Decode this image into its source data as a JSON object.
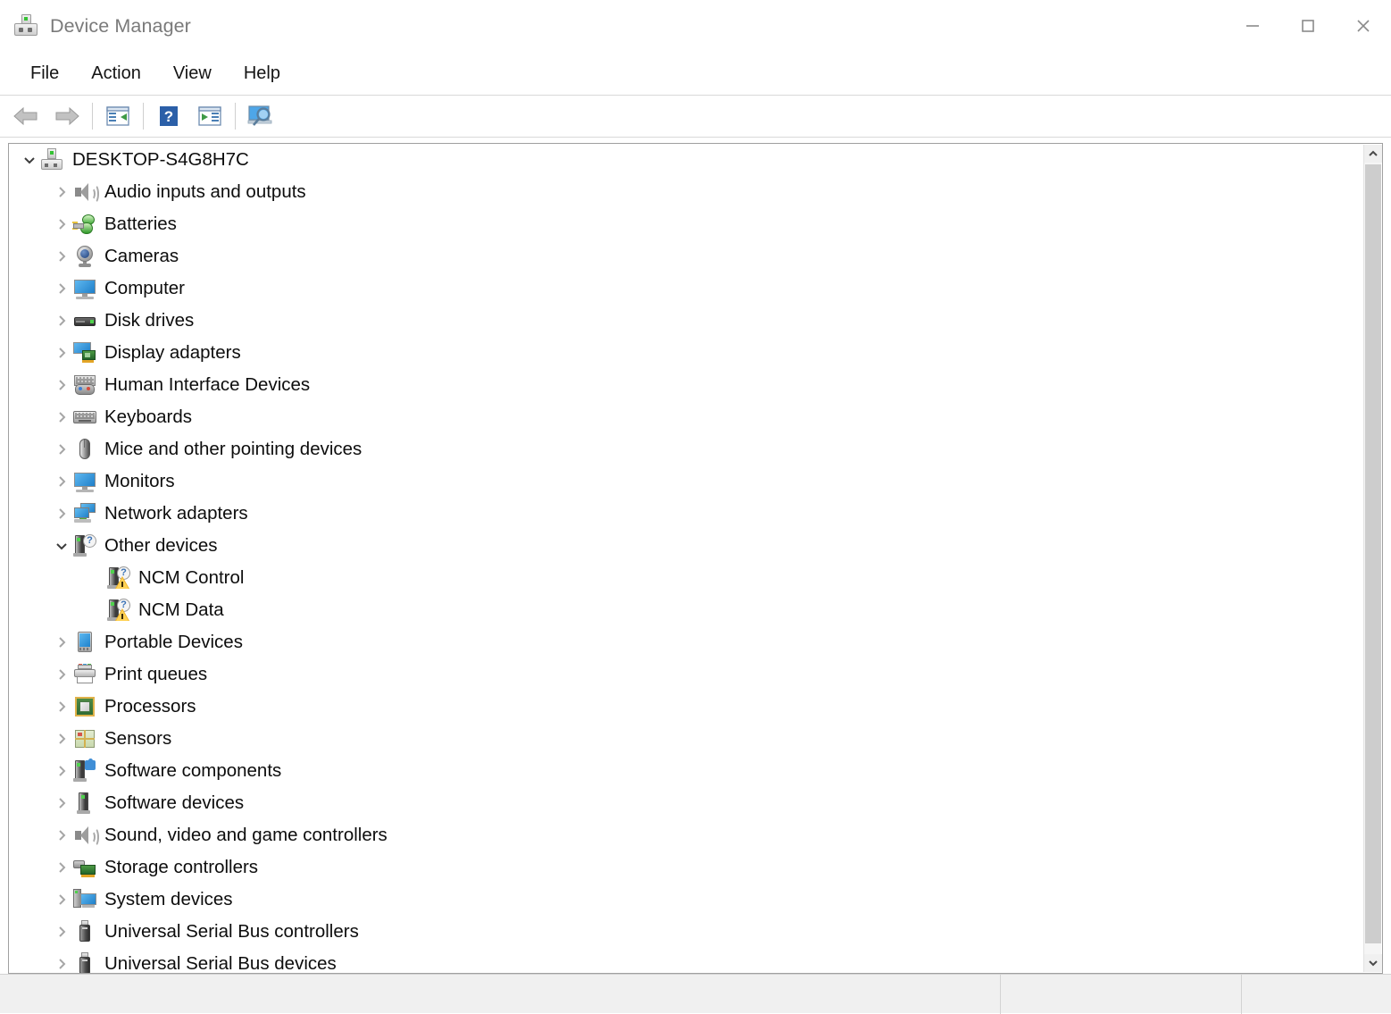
{
  "window": {
    "title": "Device Manager",
    "icon": "device-manager-icon",
    "controls": {
      "minimize": "minimize-button",
      "maximize": "maximize-button",
      "close": "close-button"
    }
  },
  "menubar": {
    "items": [
      {
        "label": "File"
      },
      {
        "label": "Action"
      },
      {
        "label": "View"
      },
      {
        "label": "Help"
      }
    ]
  },
  "toolbar": {
    "buttons": [
      {
        "name": "back-button",
        "icon": "back-arrow-icon"
      },
      {
        "name": "forward-button",
        "icon": "forward-arrow-icon"
      },
      {
        "name": "properties-button",
        "icon": "properties-icon"
      },
      {
        "name": "help-button",
        "icon": "question-mark-icon"
      },
      {
        "name": "update-driver-button",
        "icon": "update-driver-icon"
      },
      {
        "name": "scan-hardware-changes-button",
        "icon": "scan-monitor-icon"
      }
    ]
  },
  "tree": {
    "root": {
      "label": "DESKTOP-S4G8H7C",
      "expanded": true,
      "icon": "computer-icon"
    },
    "nodes": [
      {
        "label": "Audio inputs and outputs",
        "icon": "speaker-icon",
        "level": 1,
        "expanded": false,
        "hasChildren": true
      },
      {
        "label": "Batteries",
        "icon": "battery-icon",
        "level": 1,
        "expanded": false,
        "hasChildren": true
      },
      {
        "label": "Cameras",
        "icon": "camera-icon",
        "level": 1,
        "expanded": false,
        "hasChildren": true
      },
      {
        "label": "Computer",
        "icon": "monitor-icon",
        "level": 1,
        "expanded": false,
        "hasChildren": true
      },
      {
        "label": "Disk drives",
        "icon": "disk-drive-icon",
        "level": 1,
        "expanded": false,
        "hasChildren": true
      },
      {
        "label": "Display adapters",
        "icon": "display-adapter-icon",
        "level": 1,
        "expanded": false,
        "hasChildren": true
      },
      {
        "label": "Human Interface Devices",
        "icon": "hid-icon",
        "level": 1,
        "expanded": false,
        "hasChildren": true
      },
      {
        "label": "Keyboards",
        "icon": "keyboard-icon",
        "level": 1,
        "expanded": false,
        "hasChildren": true
      },
      {
        "label": "Mice and other pointing devices",
        "icon": "mouse-icon",
        "level": 1,
        "expanded": false,
        "hasChildren": true
      },
      {
        "label": "Monitors",
        "icon": "monitor-icon",
        "level": 1,
        "expanded": false,
        "hasChildren": true
      },
      {
        "label": "Network adapters",
        "icon": "network-adapter-icon",
        "level": 1,
        "expanded": false,
        "hasChildren": true
      },
      {
        "label": "Other devices",
        "icon": "unknown-device-icon",
        "level": 1,
        "expanded": true,
        "hasChildren": true
      },
      {
        "label": "NCM Control",
        "icon": "warning-device-icon",
        "level": 2,
        "expanded": false,
        "hasChildren": false
      },
      {
        "label": "NCM Data",
        "icon": "warning-device-icon",
        "level": 2,
        "expanded": false,
        "hasChildren": false
      },
      {
        "label": "Portable Devices",
        "icon": "portable-device-icon",
        "level": 1,
        "expanded": false,
        "hasChildren": true
      },
      {
        "label": "Print queues",
        "icon": "printer-icon",
        "level": 1,
        "expanded": false,
        "hasChildren": true
      },
      {
        "label": "Processors",
        "icon": "processor-icon",
        "level": 1,
        "expanded": false,
        "hasChildren": true
      },
      {
        "label": "Sensors",
        "icon": "sensor-icon",
        "level": 1,
        "expanded": false,
        "hasChildren": true
      },
      {
        "label": "Software components",
        "icon": "software-component-icon",
        "level": 1,
        "expanded": false,
        "hasChildren": true
      },
      {
        "label": "Software devices",
        "icon": "software-device-icon",
        "level": 1,
        "expanded": false,
        "hasChildren": true
      },
      {
        "label": "Sound, video and game controllers",
        "icon": "speaker-icon",
        "level": 1,
        "expanded": false,
        "hasChildren": true
      },
      {
        "label": "Storage controllers",
        "icon": "storage-controller-icon",
        "level": 1,
        "expanded": false,
        "hasChildren": true
      },
      {
        "label": "System devices",
        "icon": "system-device-icon",
        "level": 1,
        "expanded": false,
        "hasChildren": true
      },
      {
        "label": "Universal Serial Bus controllers",
        "icon": "usb-icon",
        "level": 1,
        "expanded": false,
        "hasChildren": true
      },
      {
        "label": "Universal Serial Bus devices",
        "icon": "usb-icon",
        "level": 1,
        "expanded": false,
        "hasChildren": true
      }
    ]
  },
  "scrollbar": {
    "up": "scroll-up-arrow",
    "down": "scroll-down-arrow",
    "position": "top"
  },
  "statusbar": {
    "text": "",
    "pane2": "",
    "pane3": ""
  },
  "colors": {
    "title_text": "#7a7a7a",
    "menu_text": "#141414",
    "tree_text": "#0d0d0d",
    "pane_border": "#a0a0a0",
    "statusbar_bg": "#f0f0f0",
    "scroll_thumb": "#cdcdcd",
    "accent_blue": "#2080c8",
    "warning_yellow": "#f0b429",
    "led_green": "#35c234"
  }
}
